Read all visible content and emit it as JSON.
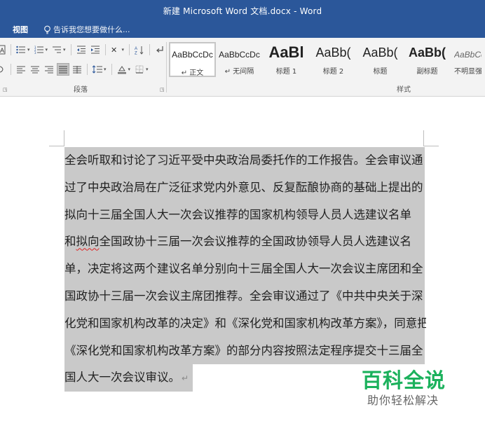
{
  "window": {
    "title": "新建 Microsoft Word 文档.docx - Word"
  },
  "tabs": {
    "view": "视图",
    "tell_me": "告诉我您想要做什么..."
  },
  "ribbon": {
    "paragraph_group_label": "段落",
    "styles_group_label": "样式",
    "styles": [
      {
        "sample": "AaBbCcDc",
        "name": "↵ 正文",
        "selected": true
      },
      {
        "sample": "AaBbCcDc",
        "name": "↵ 无间隔",
        "selected": false
      },
      {
        "sample": "AaBl",
        "name": "标题 1",
        "selected": false
      },
      {
        "sample": "AaBb(",
        "name": "标题 2",
        "selected": false
      },
      {
        "sample": "AaBb(",
        "name": "标题",
        "selected": false
      },
      {
        "sample": "AaBb(",
        "name": "副标题",
        "selected": false
      },
      {
        "sample": "AaBbCc",
        "name": "不明显强",
        "selected": false
      }
    ],
    "icons": {
      "bullets": "bullets-icon",
      "numbering": "numbering-icon",
      "multilevel": "multilevel-list-icon",
      "decrease_indent": "decrease-indent-icon",
      "increase_indent": "increase-indent-icon",
      "chinese_layout": "chinese-layout-icon",
      "sort": "sort-icon",
      "show_marks": "show-formatting-marks-icon",
      "align_left": "align-left-icon",
      "center": "align-center-icon",
      "align_right": "align-right-icon",
      "justify": "justify-icon",
      "distributed": "distributed-icon",
      "line_spacing": "line-spacing-icon",
      "shading": "shading-icon",
      "borders": "borders-icon"
    }
  },
  "document": {
    "lines": [
      "全会听取和讨论了习近平受中央政治局委托作的工作报告。全会审议通",
      "过了中央政治局在广泛征求党内外意见、反复酝酿协商的基础上提出的",
      "拟向十三届全国人大一次会议推荐的国家机构领导人员人选建议名单",
      "和拟向全国政协十三届一次会议推荐的全国政协领导人员人选建议名",
      "单，决定将这两个建议名单分别向十三届全国人大一次会议主席团和全",
      "国政协十三届一次会议主席团推荐。全会审议通过了《中共中央关于深",
      "化党和国家机构改革的决定》和《深化党和国家机构改革方案》，同意把",
      "《深化党和国家机构改革方案》的部分内容按照法定程序提交十三届全",
      "国人大一次会议审议。"
    ],
    "paragraph_mark": "↵"
  },
  "watermark": {
    "title": "百科全说",
    "subtitle": "助你轻松解决"
  },
  "colors": {
    "titlebar": "#2b579a",
    "ribbon": "#f3f3f3",
    "selection": "#c9c9c9",
    "watermark_green": "#1bb15c"
  }
}
